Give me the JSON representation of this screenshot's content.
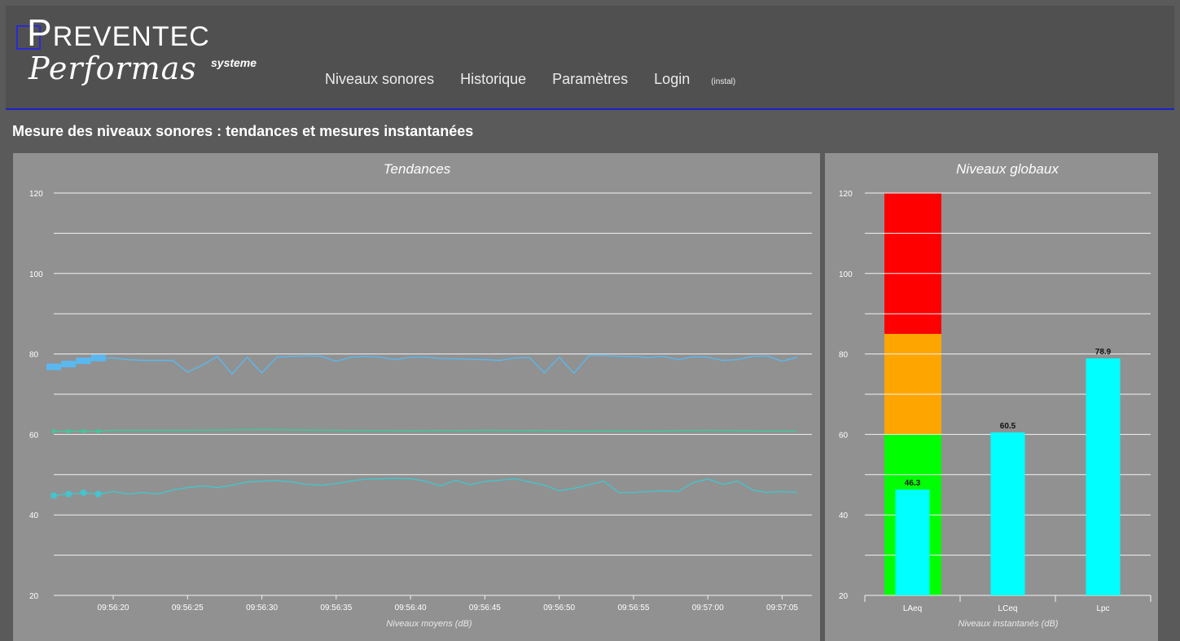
{
  "brand": {
    "logo_top_first": "P",
    "logo_top_rest": "REVENTEC",
    "logo_bottom": "Performas",
    "logo_sup": "systeme"
  },
  "nav": {
    "items": [
      "Niveaux sonores",
      "Historique",
      "Paramètres",
      "Login"
    ],
    "small": "(instal)"
  },
  "page_title": "Mesure des niveaux sonores : tendances et mesures instantanées",
  "colors": {
    "header_bg": "#505050",
    "accent_line": "#1a22c8",
    "panel_bg": "#919191",
    "series_top": "#5ab8f0",
    "series_mid": "#3ec99a",
    "series_bottom": "#45c4cc",
    "band_red": "#ff0000",
    "band_orange": "#ffa500",
    "band_green": "#00ff00",
    "bar": "#00ffff"
  },
  "chart_data": [
    {
      "type": "line",
      "title": "Tendances",
      "xlabel": "Niveaux moyens (dB)",
      "ylabel": "",
      "ylim": [
        20,
        120
      ],
      "yticks": [
        20,
        40,
        60,
        80,
        100,
        120
      ],
      "xticks": [
        "09:56:20",
        "09:56:25",
        "09:56:30",
        "09:56:35",
        "09:56:40",
        "09:56:45",
        "09:56:50",
        "09:56:55",
        "09:57:00",
        "09:57:05"
      ],
      "xlim": [
        "09:56:16",
        "09:57:07"
      ],
      "grid": true,
      "series": [
        {
          "x": [
            "09:56:16",
            "09:56:17",
            "09:56:18",
            "09:56:19",
            "09:56:20",
            "09:56:21",
            "09:56:22",
            "09:56:23",
            "09:56:24",
            "09:56:25",
            "09:56:26",
            "09:56:27",
            "09:56:28",
            "09:56:29",
            "09:56:30",
            "09:56:31",
            "09:56:32",
            "09:56:33",
            "09:56:34",
            "09:56:35",
            "09:56:36",
            "09:56:37",
            "09:56:38",
            "09:56:39",
            "09:56:40",
            "09:56:41",
            "09:56:42",
            "09:56:43",
            "09:56:44",
            "09:56:45",
            "09:56:46",
            "09:56:47",
            "09:56:48",
            "09:56:49",
            "09:56:50",
            "09:56:51",
            "09:56:52",
            "09:56:53",
            "09:56:54",
            "09:56:55",
            "09:56:56",
            "09:56:57",
            "09:56:58",
            "09:56:59",
            "09:57:00",
            "09:57:01",
            "09:57:02",
            "09:57:03",
            "09:57:04",
            "09:57:05",
            "09:57:06"
          ],
          "values": [
            76.8,
            77.5,
            78.3,
            79,
            79,
            78.6,
            78.4,
            78.4,
            78.4,
            75.5,
            77.2,
            79.4,
            75,
            79.2,
            75.3,
            79.2,
            79.4,
            79.5,
            79.4,
            78.2,
            79.2,
            79.4,
            79.2,
            78.6,
            79.2,
            79.2,
            78.9,
            78.8,
            78.7,
            78.6,
            78.4,
            79,
            79.1,
            75.3,
            79.2,
            75.2,
            79.6,
            79.6,
            79.4,
            79.4,
            79.1,
            79.4,
            78.6,
            79.3,
            79.2,
            78.4,
            78.6,
            79.4,
            79.5,
            78.2,
            79.2
          ]
        },
        {
          "x": [
            "09:56:16",
            "09:56:17",
            "09:56:18",
            "09:56:19",
            "09:56:20",
            "09:56:25",
            "09:56:30",
            "09:56:35",
            "09:56:40",
            "09:56:45",
            "09:56:50",
            "09:56:55",
            "09:57:00",
            "09:57:06"
          ],
          "values": [
            60.8,
            60.8,
            60.8,
            60.8,
            61,
            61,
            61.2,
            61,
            60.9,
            61,
            60.9,
            60.8,
            61,
            60.8
          ]
        },
        {
          "x": [
            "09:56:16",
            "09:56:17",
            "09:56:18",
            "09:56:19",
            "09:56:20",
            "09:56:21",
            "09:56:22",
            "09:56:23",
            "09:56:24",
            "09:56:25",
            "09:56:26",
            "09:56:27",
            "09:56:28",
            "09:56:29",
            "09:56:30",
            "09:56:31",
            "09:56:32",
            "09:56:33",
            "09:56:34",
            "09:56:35",
            "09:56:36",
            "09:56:37",
            "09:56:38",
            "09:56:39",
            "09:56:40",
            "09:56:41",
            "09:56:42",
            "09:56:43",
            "09:56:44",
            "09:56:45",
            "09:56:46",
            "09:56:47",
            "09:56:48",
            "09:56:49",
            "09:56:50",
            "09:56:51",
            "09:56:52",
            "09:56:53",
            "09:56:54",
            "09:56:55",
            "09:56:56",
            "09:56:57",
            "09:56:58",
            "09:56:59",
            "09:57:00",
            "09:57:01",
            "09:57:02",
            "09:57:03",
            "09:57:04",
            "09:57:05",
            "09:57:06"
          ],
          "values": [
            44.8,
            45.2,
            45.5,
            45.2,
            45.8,
            45.2,
            45.6,
            45.2,
            46.2,
            46.8,
            47.2,
            46.8,
            47.4,
            48.2,
            48.4,
            48.5,
            48.2,
            47.6,
            47.4,
            47.8,
            48.4,
            48.9,
            49,
            49.1,
            49,
            48.4,
            47.2,
            48.6,
            47.5,
            48.3,
            48.6,
            49,
            48.2,
            47.4,
            46,
            46.6,
            47.5,
            48.4,
            45.6,
            45.6,
            45.8,
            46,
            45.8,
            48,
            48.9,
            47.6,
            48.4,
            46.2,
            45.6,
            45.8,
            45.6
          ]
        }
      ]
    },
    {
      "type": "bar",
      "title": "Niveaux globaux",
      "xlabel": "Niveaux instantanés (dB)",
      "ylabel": "",
      "ylim": [
        20,
        120
      ],
      "yticks": [
        20,
        40,
        60,
        80,
        100,
        120
      ],
      "categories": [
        "LAeq",
        "LCeq",
        "Lpc"
      ],
      "values": [
        46.3,
        60.5,
        78.9
      ],
      "value_labels": [
        "46.3",
        "60.5",
        "78.9"
      ],
      "bands": [
        {
          "from": 20,
          "to": 60,
          "color": "#00ff00"
        },
        {
          "from": 60,
          "to": 85,
          "color": "#ffa500"
        },
        {
          "from": 85,
          "to": 120,
          "color": "#ff0000"
        }
      ],
      "grid": true
    }
  ]
}
